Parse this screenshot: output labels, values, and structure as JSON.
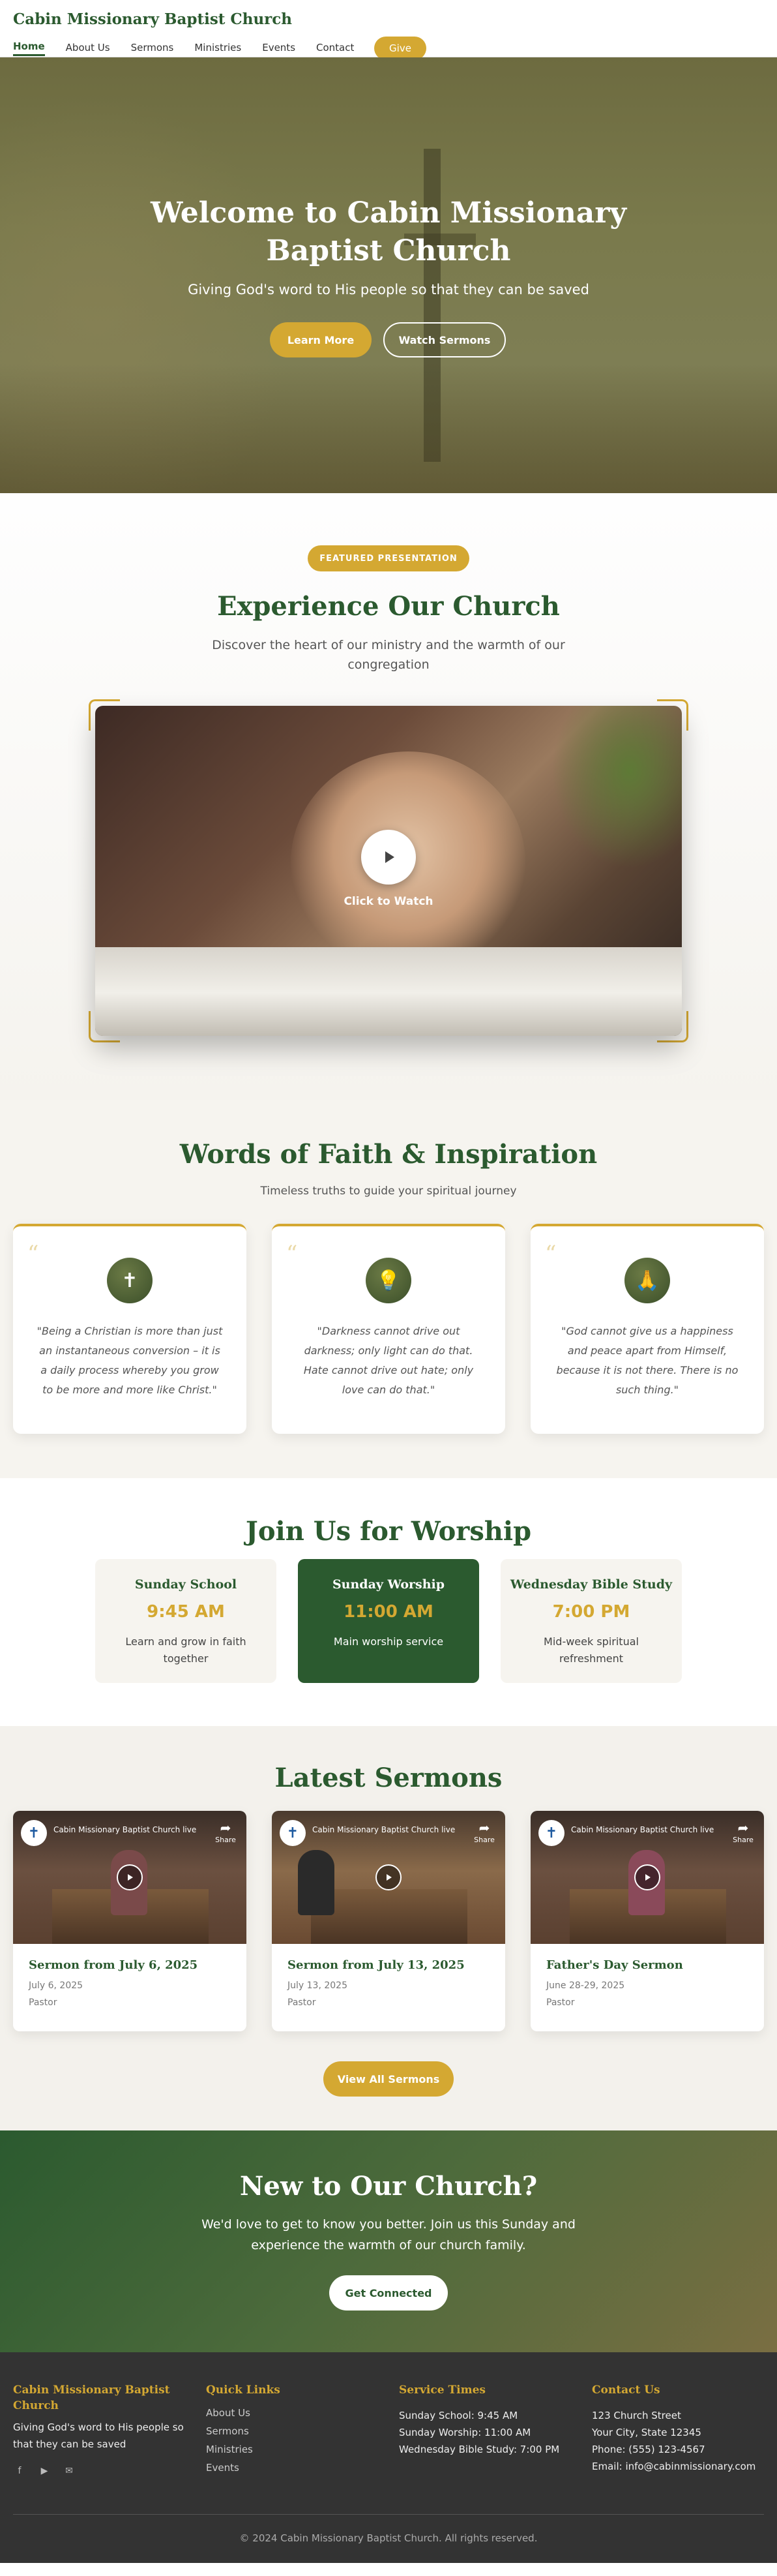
{
  "nav": {
    "brand": "Cabin Missionary Baptist Church",
    "items": [
      "Home",
      "About Us",
      "Sermons",
      "Ministries",
      "Events",
      "Contact"
    ],
    "give": "Give"
  },
  "hero": {
    "title": "Welcome to Cabin Missionary Baptist Church",
    "subtitle": "Giving God's word to His people so that they can be saved",
    "learn_more": "Learn More",
    "watch_sermons": "Watch Sermons"
  },
  "featured": {
    "badge": "FEATURED PRESENTATION",
    "title": "Experience Our Church",
    "description": "Discover the heart of our ministry and the warmth of our congregation",
    "click_to_watch": "Click to Watch"
  },
  "quotes": {
    "title": "Words of Faith & Inspiration",
    "subtitle": "Timeless truths to guide your spiritual journey",
    "items": [
      {
        "icon": "cross-icon",
        "text": "\"Being a Christian is more than just an instantaneous conversion – it is a daily process whereby you grow to be more and more like Christ.\""
      },
      {
        "icon": "lightbulb-icon",
        "text": "\"Darkness cannot drive out darkness; only light can do that. Hate cannot drive out hate; only love can do that.\""
      },
      {
        "icon": "praying-hands-icon",
        "text": "\"God cannot give us a happiness and peace apart from Himself, because it is not there. There is no such thing.\""
      }
    ]
  },
  "worship": {
    "title": "Join Us for Worship",
    "cards": [
      {
        "title": "Sunday School",
        "time": "9:45 AM",
        "desc": "Learn and grow in faith together"
      },
      {
        "title": "Sunday Worship",
        "time": "11:00 AM",
        "desc": "Main worship service"
      },
      {
        "title": "Wednesday Bible Study",
        "time": "7:00 PM",
        "desc": "Mid-week spiritual refreshment"
      }
    ]
  },
  "sermons": {
    "title": "Latest Sermons",
    "video_title": "Cabin Missionary Baptist Church live strea",
    "share": "Share",
    "items": [
      {
        "title": "Sermon from July 6, 2025",
        "date": "July 6, 2025",
        "speaker": "Pastor"
      },
      {
        "title": "Sermon from July 13, 2025",
        "date": "July 13, 2025",
        "speaker": "Pastor"
      },
      {
        "title": "Father's Day Sermon",
        "date": "June 28-29, 2025",
        "speaker": "Pastor"
      }
    ],
    "view_all": "View All Sermons"
  },
  "new_visitors": {
    "title": "New to Our Church?",
    "description": "We'd love to get to know you better. Join us this Sunday and experience the warmth of our church family.",
    "button": "Get Connected"
  },
  "footer": {
    "about_title": "Cabin Missionary Baptist Church",
    "about_text": "Giving God's word to His people so that they can be saved",
    "quick_title": "Quick Links",
    "quick_links": [
      "About Us",
      "Sermons",
      "Ministries",
      "Events"
    ],
    "times_title": "Service Times",
    "times": [
      "Sunday School: 9:45 AM",
      "Sunday Worship: 11:00 AM",
      "Wednesday Bible Study: 7:00 PM"
    ],
    "contact_title": "Contact Us",
    "contact": [
      "123 Church Street",
      "Your City, State 12345",
      "Phone: (555) 123-4567",
      "Email: info@cabinmissionary.com"
    ],
    "copyright": "© 2024 Cabin Missionary Baptist Church. All rights reserved."
  },
  "colors": {
    "primary": "#2b5a2f",
    "accent": "#d4a832",
    "footer_bg": "#333333"
  }
}
